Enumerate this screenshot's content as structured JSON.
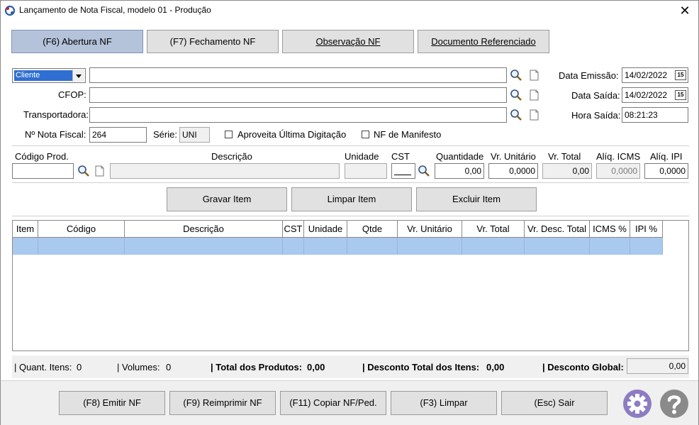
{
  "window": {
    "title": "Lançamento de Nota Fiscal, modelo 01 - Produção",
    "close_glyph": "✕"
  },
  "tabs": [
    {
      "label": "(F6) Abertura NF",
      "active": true
    },
    {
      "label": "(F7) Fechamento NF",
      "active": false
    },
    {
      "label": "Observação NF",
      "active": false
    },
    {
      "label": "Documento Referenciado",
      "active": false
    }
  ],
  "form": {
    "party_select": "Cliente",
    "party_value": "",
    "cfop_label": "CFOP:",
    "cfop_value": "",
    "transp_label": "Transportadora:",
    "transp_value": "",
    "nota_label": "Nº Nota Fiscal:",
    "nota_value": "264",
    "serie_label": "Série:",
    "serie_value": "UNI",
    "aproveita_label": "Aproveita Última Digitação",
    "manifesto_label": "NF de Manifesto",
    "emissao_label": "Data Emissão:",
    "emissao_value": "14/02/2022",
    "saida_label": "Data Saída:",
    "saida_value": "14/02/2022",
    "hora_label": "Hora Saída:",
    "hora_value": "08:21:23",
    "calendar_glyph": "15"
  },
  "item": {
    "codigo_label": "Código Prod.",
    "descricao_label": "Descrição",
    "unidade_label": "Unidade",
    "cst_label": "CST",
    "quantidade_label": "Quantidade",
    "quantidade_value": "0,00",
    "vr_unitario_label": "Vr. Unitário",
    "vr_unitario_value": "0,0000",
    "vr_total_label": "Vr. Total",
    "vr_total_value": "0,00",
    "aliq_icms_label": "Alíq. ICMS",
    "aliq_icms_value": "0,0000",
    "aliq_ipi_label": "Alíq. IPI",
    "aliq_ipi_value": "0,0000"
  },
  "item_buttons": {
    "gravar": "Gravar Item",
    "limpar": "Limpar Item",
    "excluir": "Excluir Item"
  },
  "table": {
    "columns": [
      "Item",
      "Código",
      "Descrição",
      "CST",
      "Unidade",
      "Qtde",
      "Vr. Unitário",
      "Vr. Total",
      "Vr. Desc. Total",
      "ICMS %",
      "IPI %"
    ]
  },
  "summary": {
    "quant_itens_label": "| Quant. Itens:",
    "quant_itens_value": "0",
    "volumes_label": "| Volumes:",
    "volumes_value": "0",
    "total_produtos_label": "| Total dos Produtos:",
    "total_produtos_value": "0,00",
    "desconto_itens_label": "| Desconto Total dos Itens:",
    "desconto_itens_value": "0,00",
    "desconto_global_label": "| Desconto Global:",
    "desconto_global_value": "0,00"
  },
  "actions": {
    "emitir": "(F8) Emitir NF",
    "reimprimir": "(F9) Reimprimir NF",
    "copiar": "(F11) Copiar NF/Ped.",
    "limpar": "(F3) Limpar",
    "sair": "(Esc) Sair"
  },
  "colors": {
    "accent_tab": "#b4c3da",
    "selection_row": "#a9c9ee",
    "gear": "#8e7cc3",
    "help": "#8a8a8a"
  }
}
